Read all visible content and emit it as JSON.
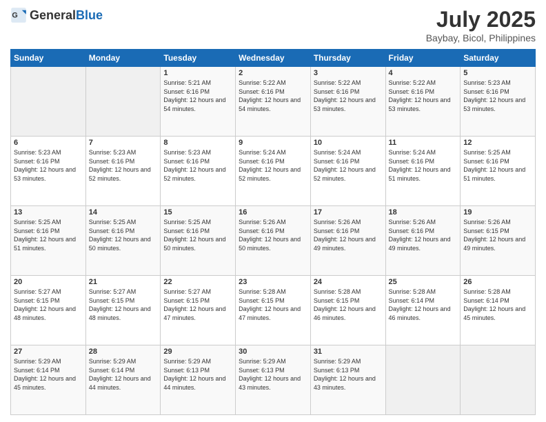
{
  "header": {
    "logo_general": "General",
    "logo_blue": "Blue",
    "month_year": "July 2025",
    "location": "Baybay, Bicol, Philippines"
  },
  "weekdays": [
    "Sunday",
    "Monday",
    "Tuesday",
    "Wednesday",
    "Thursday",
    "Friday",
    "Saturday"
  ],
  "weeks": [
    [
      {
        "day": "",
        "info": ""
      },
      {
        "day": "",
        "info": ""
      },
      {
        "day": "1",
        "info": "Sunrise: 5:21 AM\nSunset: 6:16 PM\nDaylight: 12 hours and 54 minutes."
      },
      {
        "day": "2",
        "info": "Sunrise: 5:22 AM\nSunset: 6:16 PM\nDaylight: 12 hours and 54 minutes."
      },
      {
        "day": "3",
        "info": "Sunrise: 5:22 AM\nSunset: 6:16 PM\nDaylight: 12 hours and 53 minutes."
      },
      {
        "day": "4",
        "info": "Sunrise: 5:22 AM\nSunset: 6:16 PM\nDaylight: 12 hours and 53 minutes."
      },
      {
        "day": "5",
        "info": "Sunrise: 5:23 AM\nSunset: 6:16 PM\nDaylight: 12 hours and 53 minutes."
      }
    ],
    [
      {
        "day": "6",
        "info": "Sunrise: 5:23 AM\nSunset: 6:16 PM\nDaylight: 12 hours and 53 minutes."
      },
      {
        "day": "7",
        "info": "Sunrise: 5:23 AM\nSunset: 6:16 PM\nDaylight: 12 hours and 52 minutes."
      },
      {
        "day": "8",
        "info": "Sunrise: 5:23 AM\nSunset: 6:16 PM\nDaylight: 12 hours and 52 minutes."
      },
      {
        "day": "9",
        "info": "Sunrise: 5:24 AM\nSunset: 6:16 PM\nDaylight: 12 hours and 52 minutes."
      },
      {
        "day": "10",
        "info": "Sunrise: 5:24 AM\nSunset: 6:16 PM\nDaylight: 12 hours and 52 minutes."
      },
      {
        "day": "11",
        "info": "Sunrise: 5:24 AM\nSunset: 6:16 PM\nDaylight: 12 hours and 51 minutes."
      },
      {
        "day": "12",
        "info": "Sunrise: 5:25 AM\nSunset: 6:16 PM\nDaylight: 12 hours and 51 minutes."
      }
    ],
    [
      {
        "day": "13",
        "info": "Sunrise: 5:25 AM\nSunset: 6:16 PM\nDaylight: 12 hours and 51 minutes."
      },
      {
        "day": "14",
        "info": "Sunrise: 5:25 AM\nSunset: 6:16 PM\nDaylight: 12 hours and 50 minutes."
      },
      {
        "day": "15",
        "info": "Sunrise: 5:25 AM\nSunset: 6:16 PM\nDaylight: 12 hours and 50 minutes."
      },
      {
        "day": "16",
        "info": "Sunrise: 5:26 AM\nSunset: 6:16 PM\nDaylight: 12 hours and 50 minutes."
      },
      {
        "day": "17",
        "info": "Sunrise: 5:26 AM\nSunset: 6:16 PM\nDaylight: 12 hours and 49 minutes."
      },
      {
        "day": "18",
        "info": "Sunrise: 5:26 AM\nSunset: 6:16 PM\nDaylight: 12 hours and 49 minutes."
      },
      {
        "day": "19",
        "info": "Sunrise: 5:26 AM\nSunset: 6:15 PM\nDaylight: 12 hours and 49 minutes."
      }
    ],
    [
      {
        "day": "20",
        "info": "Sunrise: 5:27 AM\nSunset: 6:15 PM\nDaylight: 12 hours and 48 minutes."
      },
      {
        "day": "21",
        "info": "Sunrise: 5:27 AM\nSunset: 6:15 PM\nDaylight: 12 hours and 48 minutes."
      },
      {
        "day": "22",
        "info": "Sunrise: 5:27 AM\nSunset: 6:15 PM\nDaylight: 12 hours and 47 minutes."
      },
      {
        "day": "23",
        "info": "Sunrise: 5:28 AM\nSunset: 6:15 PM\nDaylight: 12 hours and 47 minutes."
      },
      {
        "day": "24",
        "info": "Sunrise: 5:28 AM\nSunset: 6:15 PM\nDaylight: 12 hours and 46 minutes."
      },
      {
        "day": "25",
        "info": "Sunrise: 5:28 AM\nSunset: 6:14 PM\nDaylight: 12 hours and 46 minutes."
      },
      {
        "day": "26",
        "info": "Sunrise: 5:28 AM\nSunset: 6:14 PM\nDaylight: 12 hours and 45 minutes."
      }
    ],
    [
      {
        "day": "27",
        "info": "Sunrise: 5:29 AM\nSunset: 6:14 PM\nDaylight: 12 hours and 45 minutes."
      },
      {
        "day": "28",
        "info": "Sunrise: 5:29 AM\nSunset: 6:14 PM\nDaylight: 12 hours and 44 minutes."
      },
      {
        "day": "29",
        "info": "Sunrise: 5:29 AM\nSunset: 6:13 PM\nDaylight: 12 hours and 44 minutes."
      },
      {
        "day": "30",
        "info": "Sunrise: 5:29 AM\nSunset: 6:13 PM\nDaylight: 12 hours and 43 minutes."
      },
      {
        "day": "31",
        "info": "Sunrise: 5:29 AM\nSunset: 6:13 PM\nDaylight: 12 hours and 43 minutes."
      },
      {
        "day": "",
        "info": ""
      },
      {
        "day": "",
        "info": ""
      }
    ]
  ]
}
